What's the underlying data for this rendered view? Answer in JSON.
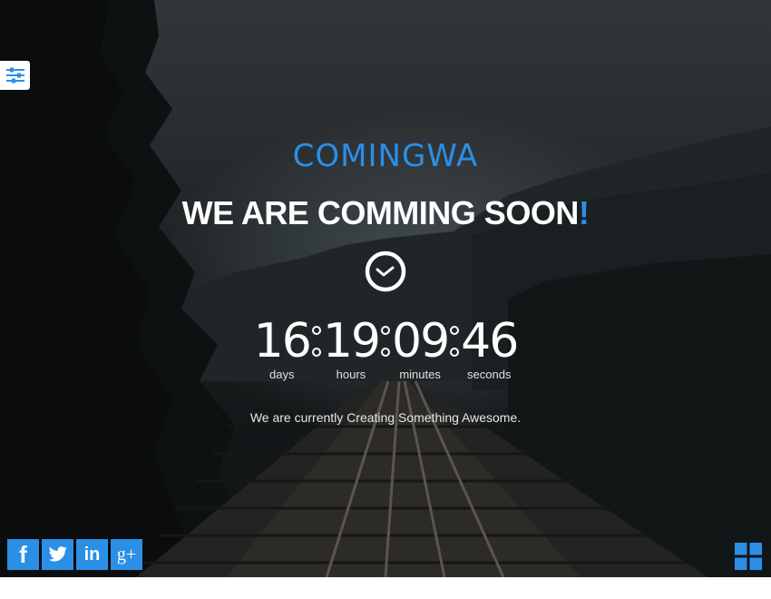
{
  "brand": {
    "name": "COMINGWA"
  },
  "headline": {
    "text": "WE ARE COMMING SOON",
    "accent": "!"
  },
  "countdown": [
    {
      "value": "16",
      "label": "days"
    },
    {
      "value": "19",
      "label": "hours"
    },
    {
      "value": "09",
      "label": "minutes"
    },
    {
      "value": "46",
      "label": "seconds"
    }
  ],
  "tagline": "We are currently Creating Something Awesome.",
  "social": [
    {
      "name": "facebook",
      "glyph": "f"
    },
    {
      "name": "twitter",
      "glyph": ""
    },
    {
      "name": "linkedin",
      "glyph": "in"
    },
    {
      "name": "google-plus",
      "glyph": "g+"
    }
  ],
  "icons": {
    "settings": "sliders-icon",
    "clock": "clock-icon",
    "menu": "grid-icon"
  },
  "colors": {
    "accent": "#2b8fe6",
    "text": "#ffffff",
    "background": "#1c2123"
  }
}
